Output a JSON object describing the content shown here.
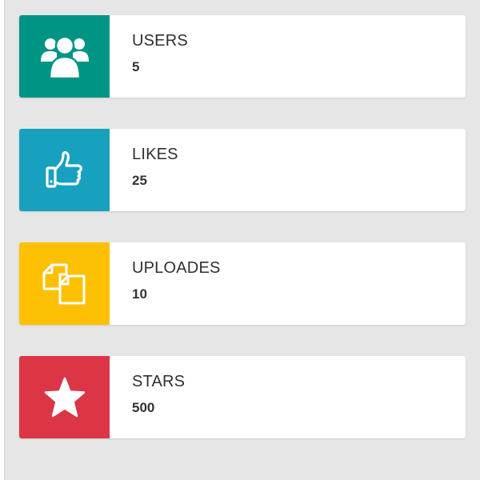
{
  "stats": [
    {
      "label": "USERS",
      "value": "5",
      "icon": "users-icon",
      "color": "#009485"
    },
    {
      "label": "LIKES",
      "value": "25",
      "icon": "thumbs-up-icon",
      "color": "#17a1be"
    },
    {
      "label": "UPLOADES",
      "value": "10",
      "icon": "files-icon",
      "color": "#fdc002"
    },
    {
      "label": "STARS",
      "value": "500",
      "icon": "star-icon",
      "color": "#dc3546"
    }
  ]
}
